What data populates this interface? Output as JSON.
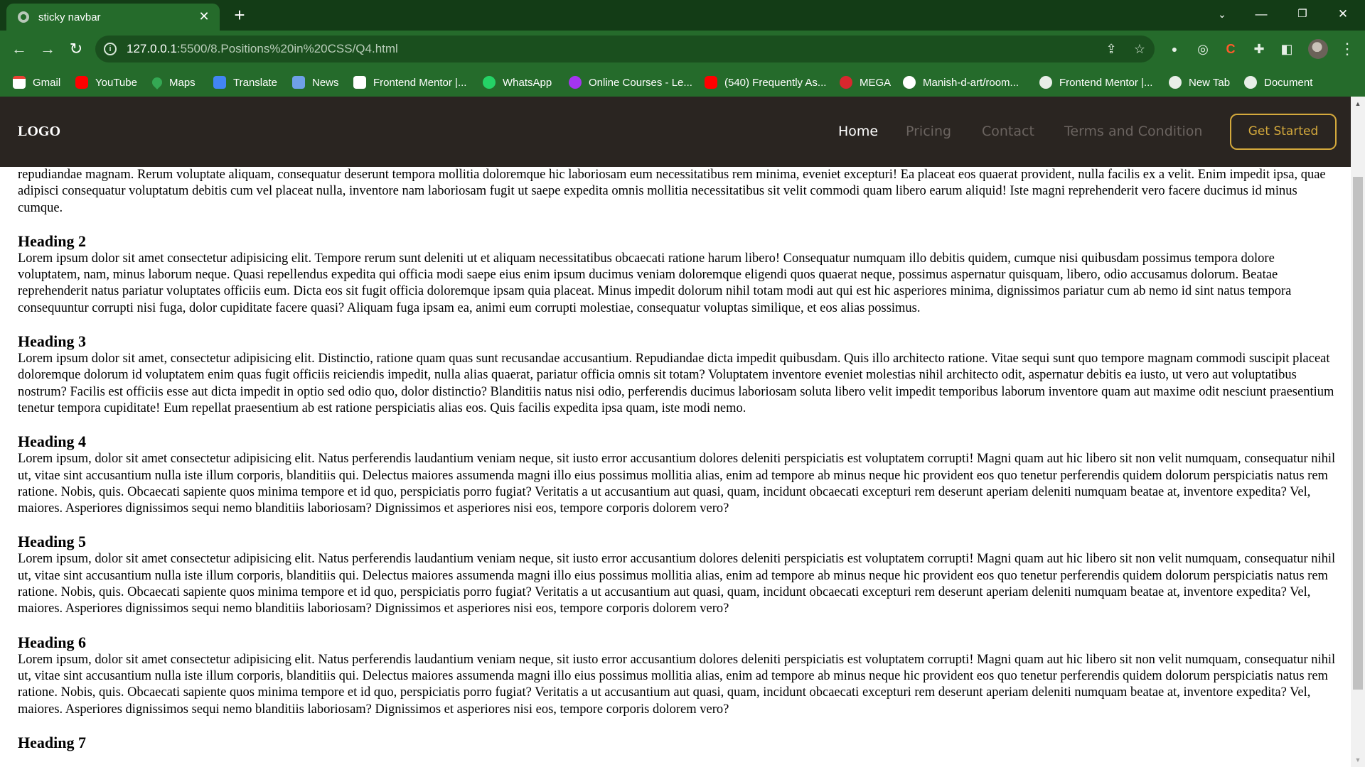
{
  "browser": {
    "tab_title": "sticky navbar",
    "url_host": "127.0.0.1",
    "url_path": ":5500/8.Positions%20in%20CSS/Q4.html",
    "bookmarks": [
      {
        "label": "Gmail",
        "icon": "gmail-icon"
      },
      {
        "label": "YouTube",
        "icon": "youtube-icon"
      },
      {
        "label": "Maps",
        "icon": "maps-icon"
      },
      {
        "label": "Translate",
        "icon": "translate-icon"
      },
      {
        "label": "News",
        "icon": "news-icon"
      },
      {
        "label": "Frontend Mentor |...",
        "icon": "frontend-mentor-icon"
      },
      {
        "label": "WhatsApp",
        "icon": "whatsapp-icon"
      },
      {
        "label": "Online Courses - Le...",
        "icon": "courses-icon"
      },
      {
        "label": "(540) Frequently As...",
        "icon": "youtube-icon"
      },
      {
        "label": "MEGA",
        "icon": "mega-icon"
      },
      {
        "label": "Manish-d-art/room...",
        "icon": "github-icon"
      },
      {
        "label": "Frontend Mentor |...",
        "icon": "globe-icon"
      },
      {
        "label": "New Tab",
        "icon": "globe-icon"
      },
      {
        "label": "Document",
        "icon": "globe-icon"
      }
    ]
  },
  "navbar": {
    "logo": "LOGO",
    "links": [
      "Home",
      "Pricing",
      "Contact",
      "Terms and Condition"
    ],
    "cta": "Get Started"
  },
  "content": {
    "partial_paragraph": "repudiandae magnam. Rerum voluptate aliquam, consequatur deserunt tempora mollitia doloremque hic laboriosam eum necessitatibus rem minima, eveniet excepturi! Ea placeat eos quaerat provident, nulla facilis ex a velit. Enim impedit ipsa, quae adipisci consequatur voluptatum debitis cum vel placeat nulla, inventore nam laboriosam fugit ut saepe expedita omnis mollitia necessitatibus sit velit commodi quam libero earum aliquid! Iste magni reprehenderit vero facere ducimus id minus cumque.",
    "sections": [
      {
        "heading": "Heading 2",
        "text": "Lorem ipsum dolor sit amet consectetur adipisicing elit. Tempore rerum sunt deleniti ut et aliquam necessitatibus obcaecati ratione harum libero! Consequatur numquam illo debitis quidem, cumque nisi quibusdam possimus tempora dolore voluptatem, nam, minus laborum neque. Quasi repellendus expedita qui officia modi saepe eius enim ipsum ducimus veniam doloremque eligendi quos quaerat neque, possimus aspernatur quisquam, libero, odio accusamus dolorum. Beatae reprehenderit natus pariatur voluptates officiis eum. Dicta eos sit fugit officia doloremque ipsam quia placeat. Minus impedit dolorum nihil totam modi aut qui est hic asperiores minima, dignissimos pariatur cum ab nemo id sint natus tempora consequuntur corrupti nisi fuga, dolor cupiditate facere quasi? Aliquam fuga ipsam ea, animi eum corrupti molestiae, consequatur voluptas similique, et eos alias possimus."
      },
      {
        "heading": "Heading 3",
        "text": "Lorem ipsum dolor sit amet, consectetur adipisicing elit. Distinctio, ratione quam quas sunt recusandae accusantium. Repudiandae dicta impedit quibusdam. Quis illo architecto ratione. Vitae sequi sunt quo tempore magnam commodi suscipit placeat doloremque dolorum id voluptatem enim quas fugit officiis reiciendis impedit, nulla alias quaerat, pariatur officia omnis sit totam? Voluptatem inventore eveniet molestias nihil architecto odit, aspernatur debitis ea iusto, ut vero aut voluptatibus nostrum? Facilis est officiis esse aut dicta impedit in optio sed odio quo, dolor distinctio? Blanditiis natus nisi odio, perferendis ducimus laboriosam soluta libero velit impedit temporibus laborum inventore quam aut maxime odit nesciunt praesentium tenetur tempora cupiditate! Eum repellat praesentium ab est ratione perspiciatis alias eos. Quis facilis expedita ipsa quam, iste modi nemo."
      },
      {
        "heading": "Heading 4",
        "text": "Lorem ipsum, dolor sit amet consectetur adipisicing elit. Natus perferendis laudantium veniam neque, sit iusto error accusantium dolores deleniti perspiciatis est voluptatem corrupti! Magni quam aut hic libero sit non velit numquam, consequatur nihil ut, vitae sint accusantium nulla iste illum corporis, blanditiis qui. Delectus maiores assumenda magni illo eius possimus mollitia alias, enim ad tempore ab minus neque hic provident eos quo tenetur perferendis quidem dolorum perspiciatis natus rem ratione. Nobis, quis. Obcaecati sapiente quos minima tempore et id quo, perspiciatis porro fugiat? Veritatis a ut accusantium aut quasi, quam, incidunt obcaecati excepturi rem deserunt aperiam deleniti numquam beatae at, inventore expedita? Vel, maiores. Asperiores dignissimos sequi nemo blanditiis laboriosam? Dignissimos et asperiores nisi eos, tempore corporis dolorem vero?"
      },
      {
        "heading": "Heading 5",
        "text": "Lorem ipsum, dolor sit amet consectetur adipisicing elit. Natus perferendis laudantium veniam neque, sit iusto error accusantium dolores deleniti perspiciatis est voluptatem corrupti! Magni quam aut hic libero sit non velit numquam, consequatur nihil ut, vitae sint accusantium nulla iste illum corporis, blanditiis qui. Delectus maiores assumenda magni illo eius possimus mollitia alias, enim ad tempore ab minus neque hic provident eos quo tenetur perferendis quidem dolorum perspiciatis natus rem ratione. Nobis, quis. Obcaecati sapiente quos minima tempore et id quo, perspiciatis porro fugiat? Veritatis a ut accusantium aut quasi, quam, incidunt obcaecati excepturi rem deserunt aperiam deleniti numquam beatae at, inventore expedita? Vel, maiores. Asperiores dignissimos sequi nemo blanditiis laboriosam? Dignissimos et asperiores nisi eos, tempore corporis dolorem vero?"
      },
      {
        "heading": "Heading 6",
        "text": "Lorem ipsum, dolor sit amet consectetur adipisicing elit. Natus perferendis laudantium veniam neque, sit iusto error accusantium dolores deleniti perspiciatis est voluptatem corrupti! Magni quam aut hic libero sit non velit numquam, consequatur nihil ut, vitae sint accusantium nulla iste illum corporis, blanditiis qui. Delectus maiores assumenda magni illo eius possimus mollitia alias, enim ad tempore ab minus neque hic provident eos quo tenetur perferendis quidem dolorum perspiciatis natus rem ratione. Nobis, quis. Obcaecati sapiente quos minima tempore et id quo, perspiciatis porro fugiat? Veritatis a ut accusantium aut quasi, quam, incidunt obcaecati excepturi rem deserunt aperiam deleniti numquam beatae at, inventore expedita? Vel, maiores. Asperiores dignissimos sequi nemo blanditiis laboriosam? Dignissimos et asperiores nisi eos, tempore corporis dolorem vero?"
      },
      {
        "heading": "Heading 7",
        "text": ""
      }
    ]
  },
  "colors": {
    "tabbar_bg": "#133c16",
    "toolbar_bg": "#256b2b",
    "navbar_bg": "#2a2521",
    "accent": "#d4a93c",
    "nav_inactive": "#6b6460"
  }
}
